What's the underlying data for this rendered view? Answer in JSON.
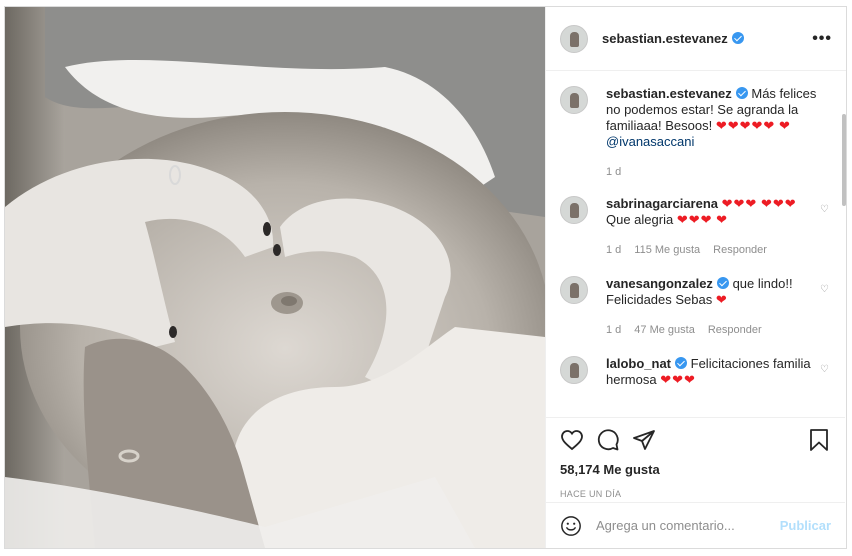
{
  "post": {
    "username": "sebastian.estevanez",
    "photo_alt": "Foto de embarazo con manos formando un corazón",
    "more_icon": "more-icon"
  },
  "caption": {
    "username": "sebastian.estevanez",
    "text": "Más felices no podemos estar! Se agranda la familiaaa! Besoos!",
    "hearts_a": "❤❤❤❤❤",
    "hearts_b": "❤",
    "mention": "@ivanasaccani",
    "time": "1 d"
  },
  "comments": [
    {
      "username": "sabrinagarciarena",
      "text_pre": "❤❤❤",
      "text_mid": "❤❤❤",
      "text": "Que alegria",
      "text_post": "❤❤❤",
      "text_end": "❤",
      "time": "1 d",
      "likes": "115 Me gusta",
      "reply": "Responder"
    },
    {
      "username": "vanesangonzalez",
      "text": "que lindo!! Felicidades Sebas",
      "text_post": "❤",
      "time": "1 d",
      "likes": "47 Me gusta",
      "reply": "Responder"
    },
    {
      "username": "lalobo_nat",
      "text": "Felicitaciones familia hermosa",
      "text_post": "❤❤❤"
    }
  ],
  "actions": {
    "likes": "58,174 Me gusta",
    "when": "HACE UN DÍA"
  },
  "add_comment": {
    "placeholder": "Agrega un comentario...",
    "publish": "Publicar"
  },
  "colors": {
    "accent": "#3897f0",
    "heart": "#ed1c24",
    "publish_disabled": "#b2dffc",
    "muted": "#8e8e8e"
  }
}
